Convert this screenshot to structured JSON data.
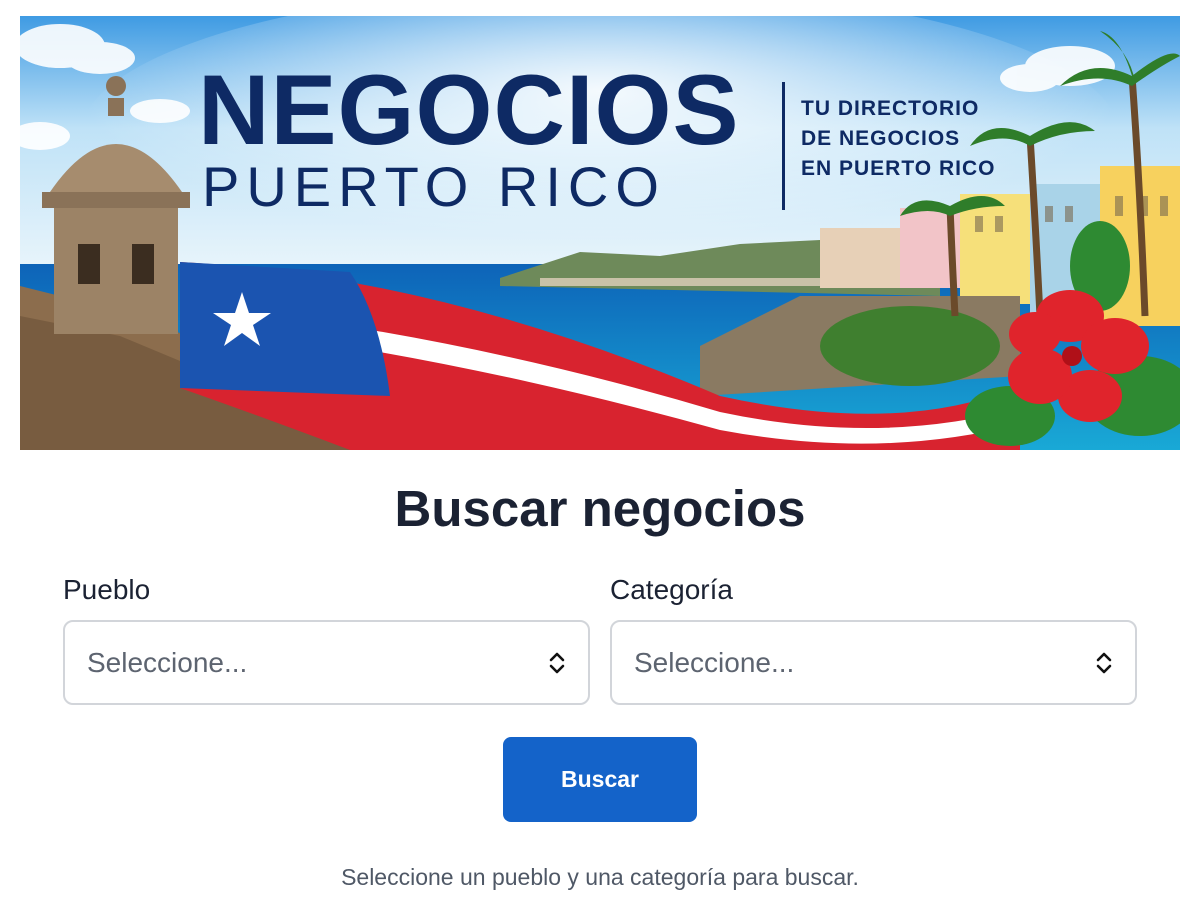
{
  "banner": {
    "brand_main": "NEGOCIOS",
    "brand_sub": "PUERTO RICO",
    "tagline": [
      "TU DIRECTORIO",
      "DE NEGOCIOS",
      "EN PUERTO RICO"
    ]
  },
  "main": {
    "title": "Buscar negocios",
    "pueblo": {
      "label": "Pueblo",
      "placeholder": "Seleccione..."
    },
    "categoria": {
      "label": "Categoría",
      "placeholder": "Seleccione..."
    },
    "search_label": "Buscar",
    "hint": "Seleccione un pueblo y una categoría para buscar."
  },
  "colors": {
    "brand_navy": "#0e2a64",
    "primary_button": "#1463c9",
    "title_text": "#1b2233"
  },
  "icons": {
    "select_arrow": "chevron-updown-icon",
    "flag_star": "star-icon"
  }
}
